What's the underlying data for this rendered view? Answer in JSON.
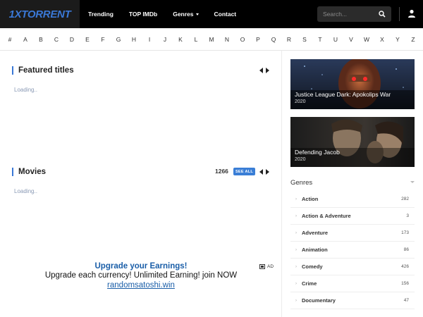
{
  "header": {
    "logo": "1XTORRENT",
    "nav": [
      {
        "label": "Trending"
      },
      {
        "label": "TOP IMDb"
      },
      {
        "label": "Genres"
      },
      {
        "label": "Contact"
      }
    ],
    "search_placeholder": "Search..."
  },
  "alphabet": [
    "#",
    "A",
    "B",
    "C",
    "D",
    "E",
    "F",
    "G",
    "H",
    "I",
    "J",
    "K",
    "L",
    "M",
    "N",
    "O",
    "P",
    "Q",
    "R",
    "S",
    "T",
    "U",
    "V",
    "W",
    "X",
    "Y",
    "Z"
  ],
  "featured": {
    "title": "Featured titles",
    "loading": "Loading.."
  },
  "movies": {
    "title": "Movies",
    "count": "1266",
    "see_all": "SEE ALL",
    "loading": "Loading.."
  },
  "ad": {
    "title": "Upgrade your Earnings!",
    "body": "Upgrade each currency! Unlimited Earning! join NOW",
    "link": "randomsatoshi.win",
    "badge": "AD"
  },
  "sidebar": {
    "cards": [
      {
        "title": "Justice League Dark: Apokolips War",
        "year": "2020"
      },
      {
        "title": "Defending Jacob",
        "year": "2020"
      }
    ],
    "genres_title": "Genres",
    "genres": [
      {
        "name": "Action",
        "count": "282"
      },
      {
        "name": "Action & Adventure",
        "count": "3"
      },
      {
        "name": "Adventure",
        "count": "173"
      },
      {
        "name": "Animation",
        "count": "86"
      },
      {
        "name": "Comedy",
        "count": "426"
      },
      {
        "name": "Crime",
        "count": "156"
      },
      {
        "name": "Documentary",
        "count": "47"
      }
    ]
  },
  "colors": {
    "accent": "#3a78d6",
    "topbar": "#000000"
  }
}
